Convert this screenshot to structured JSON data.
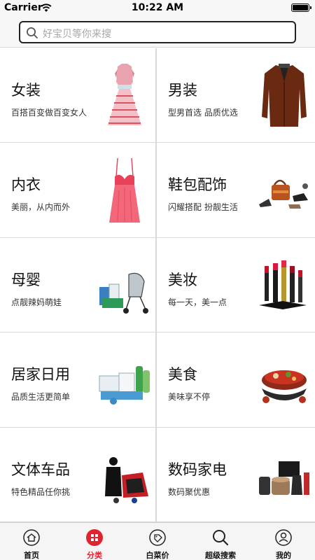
{
  "status_bar": {
    "carrier": "Carrier",
    "time": "10:22 AM"
  },
  "search": {
    "placeholder": "好宝贝等你来搜"
  },
  "categories": [
    {
      "title": "女装",
      "subtitle": "百搭百变做百变女人",
      "icon": "dress-image"
    },
    {
      "title": "男装",
      "subtitle": "型男首选 品质优选",
      "icon": "coat-image"
    },
    {
      "title": "内衣",
      "subtitle": "美丽，从内而外",
      "icon": "lingerie-image"
    },
    {
      "title": "鞋包配饰",
      "subtitle": "闪耀搭配 扮靓生活",
      "icon": "shoes-bags-image"
    },
    {
      "title": "母婴",
      "subtitle": "点靓辣妈萌娃",
      "icon": "stroller-image"
    },
    {
      "title": "美妆",
      "subtitle": "每一天，美一点",
      "icon": "lipstick-image"
    },
    {
      "title": "居家日用",
      "subtitle": "品质生活更简单",
      "icon": "household-image"
    },
    {
      "title": "美食",
      "subtitle": "美味享不停",
      "icon": "hotpot-image"
    },
    {
      "title": "文体车品",
      "subtitle": "特色精品任你挑",
      "icon": "sports-car-image"
    },
    {
      "title": "数码家电",
      "subtitle": "数码聚优惠",
      "icon": "appliance-image"
    }
  ],
  "tabbar": [
    {
      "label": "首页",
      "icon": "home-icon",
      "active": false
    },
    {
      "label": "分类",
      "icon": "category-icon",
      "active": true
    },
    {
      "label": "白菜价",
      "icon": "tag-icon",
      "active": false
    },
    {
      "label": "超级搜索",
      "icon": "search-icon",
      "active": false
    },
    {
      "label": "我的",
      "icon": "profile-icon",
      "active": false
    }
  ],
  "colors": {
    "accent": "#e0242f",
    "divider": "#d9d9d9"
  }
}
